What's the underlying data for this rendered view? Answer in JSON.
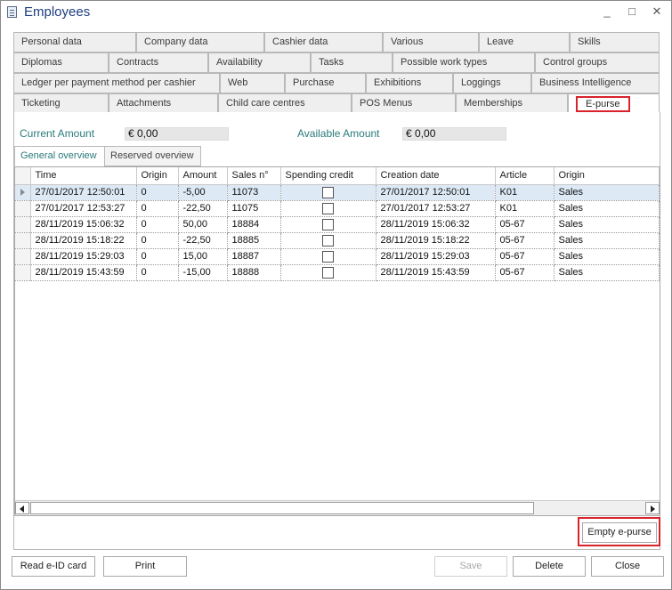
{
  "window": {
    "title": "Employees",
    "controls": [
      "_",
      "□",
      "✕"
    ]
  },
  "tabs": {
    "row1": [
      "Personal data",
      "Company data",
      "Cashier data",
      "Various",
      "Leave",
      "Skills"
    ],
    "row2": [
      "Diplomas",
      "Contracts",
      "Availability",
      "Tasks",
      "Possible work types",
      "Control groups"
    ],
    "row3": [
      "Ledger per payment method per cashier",
      "Web",
      "Purchase",
      "Exhibitions",
      "Loggings",
      "Business Intelligence"
    ],
    "row4": [
      "Ticketing",
      "Attachments",
      "Child care centres",
      "POS Menus",
      "Memberships",
      "E-purse"
    ],
    "active": "E-purse"
  },
  "amounts": {
    "current_label": "Current Amount",
    "current_value": "€ 0,00",
    "available_label": "Available Amount",
    "available_value": "€ 0,00"
  },
  "subtabs": [
    "General overview",
    "Reserved overview"
  ],
  "grid": {
    "columns": [
      "Time",
      "Origin",
      "Amount",
      "Sales n°",
      "Spending credit",
      "Creation date",
      "Article",
      "Origin"
    ],
    "rows": [
      {
        "time": "27/01/2017 12:50:01",
        "origin": "0",
        "amount": "-5,00",
        "sales_no": "11073",
        "spending_credit": false,
        "creation_date": "27/01/2017 12:50:01",
        "article": "K01",
        "origin2": "Sales"
      },
      {
        "time": "27/01/2017 12:53:27",
        "origin": "0",
        "amount": "-22,50",
        "sales_no": "11075",
        "spending_credit": false,
        "creation_date": "27/01/2017 12:53:27",
        "article": "K01",
        "origin2": "Sales"
      },
      {
        "time": "28/11/2019 15:06:32",
        "origin": "0",
        "amount": "50,00",
        "sales_no": "18884",
        "spending_credit": false,
        "creation_date": "28/11/2019 15:06:32",
        "article": "05-67",
        "origin2": "Sales"
      },
      {
        "time": "28/11/2019 15:18:22",
        "origin": "0",
        "amount": "-22,50",
        "sales_no": "18885",
        "spending_credit": false,
        "creation_date": "28/11/2019 15:18:22",
        "article": "05-67",
        "origin2": "Sales"
      },
      {
        "time": "28/11/2019 15:29:03",
        "origin": "0",
        "amount": "15,00",
        "sales_no": "18887",
        "spending_credit": false,
        "creation_date": "28/11/2019 15:29:03",
        "article": "05-67",
        "origin2": "Sales"
      },
      {
        "time": "28/11/2019 15:43:59",
        "origin": "0",
        "amount": "-15,00",
        "sales_no": "18888",
        "spending_credit": false,
        "creation_date": "28/11/2019 15:43:59",
        "article": "05-67",
        "origin2": "Sales"
      }
    ]
  },
  "buttons": {
    "empty_epurse": "Empty e-purse",
    "read_eid": "Read e-ID card",
    "print": "Print",
    "save": "Save",
    "delete": "Delete",
    "close": "Close"
  },
  "colors": {
    "highlight": "#d8232a",
    "accent_text": "#2b7a7a",
    "title_text": "#1f3d82",
    "selected_row": "#dde9f5"
  }
}
